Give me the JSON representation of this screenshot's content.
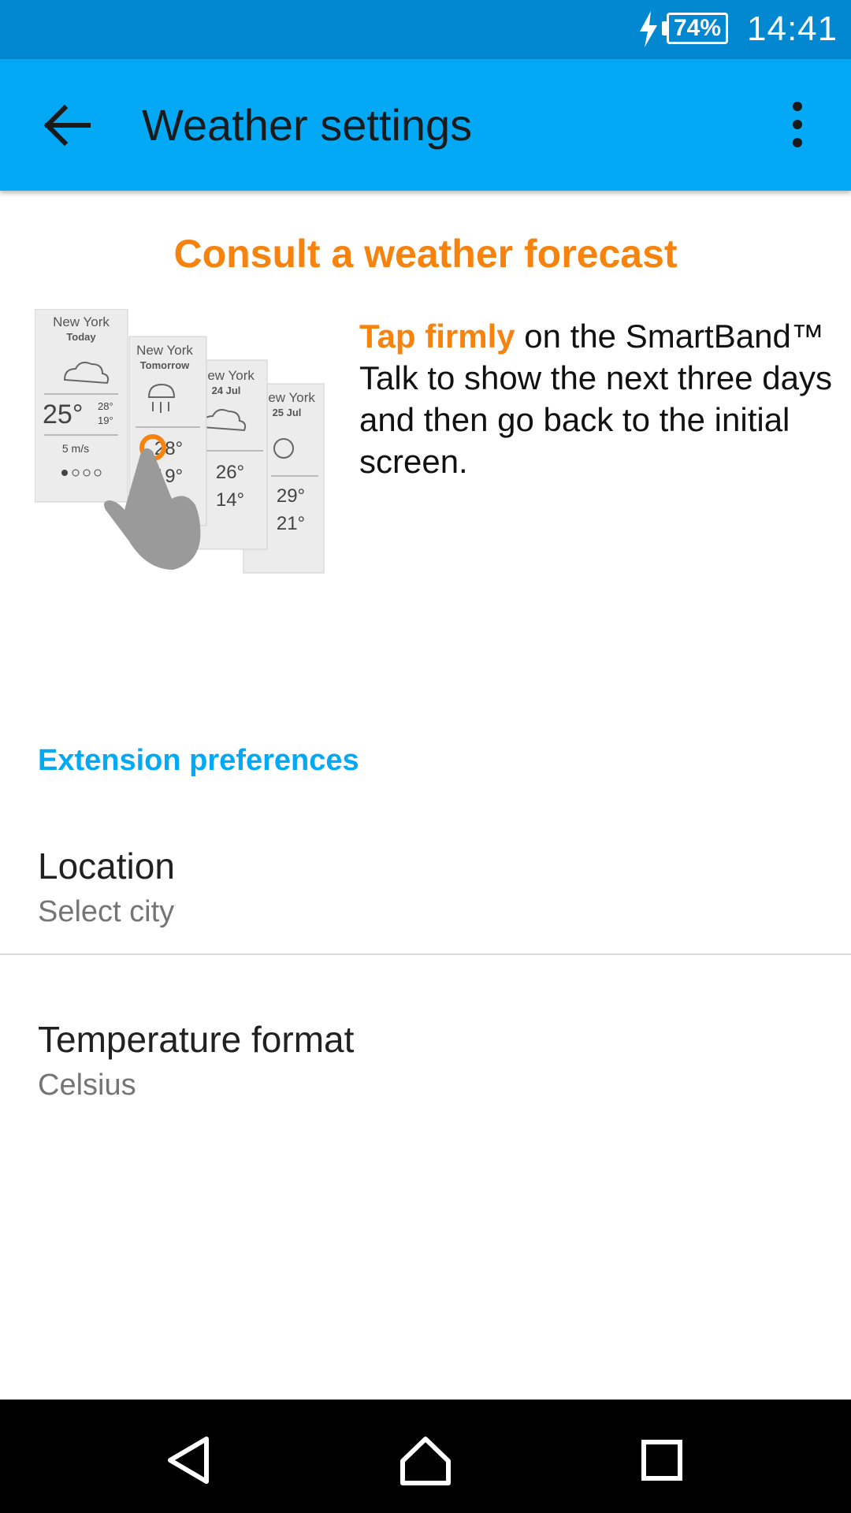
{
  "status_bar": {
    "battery": "74%",
    "time": "14:41"
  },
  "app_bar": {
    "title": "Weather settings"
  },
  "intro": {
    "headline": "Consult a weather forecast",
    "highlight": "Tap firmly",
    "description": " on the SmartBand™ Talk to show the next three days and then go back to the initial screen."
  },
  "illustration": {
    "cards": [
      {
        "city": "New York",
        "day": "Today",
        "temp": "25°",
        "high": "28°",
        "low": "19°",
        "wind": "5 m/s"
      },
      {
        "city": "New York",
        "day": "Tomorrow",
        "high": "28°",
        "low": "19°"
      },
      {
        "city": "New York",
        "day": "24 Jul",
        "high": "26°",
        "low": "14°"
      },
      {
        "city": "New York",
        "day": "25 Jul",
        "high": "29°",
        "low": "21°"
      }
    ]
  },
  "preferences": {
    "section_title": "Extension preferences",
    "location": {
      "title": "Location",
      "summary": "Select city"
    },
    "temperature": {
      "title": "Temperature format",
      "summary": "Celsius"
    }
  },
  "colors": {
    "status_bar": "#0288d1",
    "app_bar": "#03a9f4",
    "accent_orange": "#f7830f",
    "section_blue": "#03a9f4"
  },
  "icons": {
    "back": "arrow-left-icon",
    "overflow": "more-vert-icon",
    "charging": "bolt-icon",
    "nav_back": "triangle-back-icon",
    "nav_home": "home-icon",
    "nav_recents": "square-recents-icon"
  }
}
